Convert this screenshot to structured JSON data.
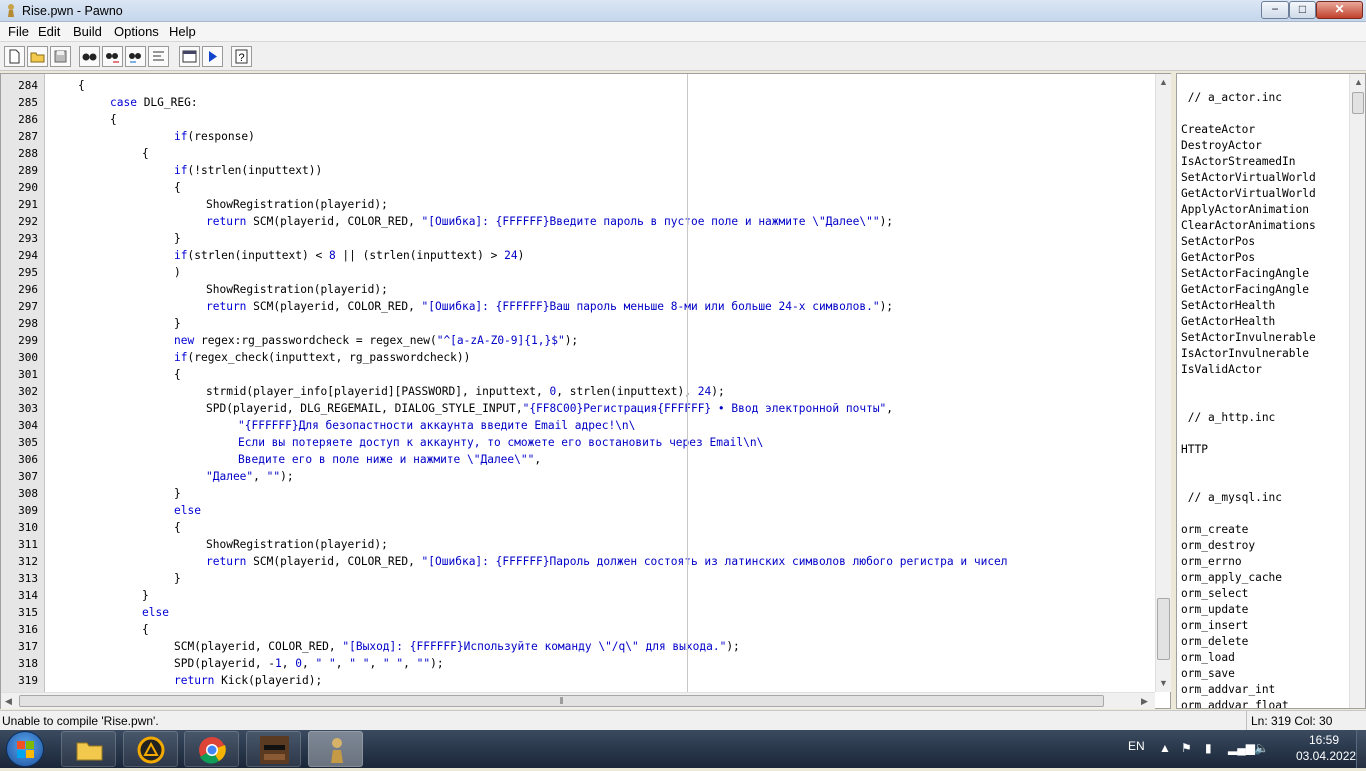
{
  "window": {
    "title": "Rise.pwn - Pawno",
    "minimize_label": "−",
    "maximize_label": "□",
    "close_label": "✕"
  },
  "menu": [
    "File",
    "Edit",
    "Build",
    "Options",
    "Help"
  ],
  "toolbar": [
    "new-icon",
    "open-icon",
    "save-icon",
    "find-icon",
    "find-next-icon",
    "replace-icon",
    "goto-line-icon",
    "function-list-icon",
    "compile-run-icon",
    "help-icon"
  ],
  "editor": {
    "lines": [
      {
        "n": "284",
        "indent": 4,
        "parts": [
          [
            "t",
            "{"
          ]
        ]
      },
      {
        "n": "285",
        "indent": 8,
        "parts": [
          [
            "k",
            "case"
          ],
          [
            "t",
            " DLG_REG:"
          ]
        ]
      },
      {
        "n": "286",
        "indent": 8,
        "parts": [
          [
            "t",
            "{"
          ]
        ]
      },
      {
        "n": "287",
        "indent": 16,
        "parts": [
          [
            "k",
            "if"
          ],
          [
            "t",
            "(response)"
          ]
        ]
      },
      {
        "n": "288",
        "indent": 12,
        "parts": [
          [
            "t",
            "{"
          ]
        ]
      },
      {
        "n": "289",
        "indent": 16,
        "parts": [
          [
            "k",
            "if"
          ],
          [
            "t",
            "(!strlen(inputtext))"
          ]
        ]
      },
      {
        "n": "290",
        "indent": 16,
        "parts": [
          [
            "t",
            "{"
          ]
        ]
      },
      {
        "n": "291",
        "indent": 20,
        "parts": [
          [
            "t",
            "ShowRegistration(playerid);"
          ]
        ]
      },
      {
        "n": "292",
        "indent": 20,
        "parts": [
          [
            "k",
            "return"
          ],
          [
            "t",
            " SCM(playerid, COLOR_RED, "
          ],
          [
            "s",
            "\"[Ошибка]: {FFFFFF}Введите пароль в пустое поле и нажмите \\\"Далее\\\"\""
          ],
          [
            "t",
            ");"
          ]
        ]
      },
      {
        "n": "293",
        "indent": 16,
        "parts": [
          [
            "t",
            "}"
          ]
        ]
      },
      {
        "n": "294",
        "indent": 16,
        "parts": [
          [
            "k",
            "if"
          ],
          [
            "t",
            "(strlen(inputtext) < "
          ],
          [
            "s",
            "8"
          ],
          [
            "t",
            " || (strlen(inputtext) > "
          ],
          [
            "s",
            "24"
          ],
          [
            "t",
            ")"
          ]
        ]
      },
      {
        "n": "295",
        "indent": 16,
        "parts": [
          [
            "t",
            ")"
          ]
        ]
      },
      {
        "n": "296",
        "indent": 20,
        "parts": [
          [
            "t",
            "ShowRegistration(playerid);"
          ]
        ]
      },
      {
        "n": "297",
        "indent": 20,
        "parts": [
          [
            "k",
            "return"
          ],
          [
            "t",
            " SCM(playerid, COLOR_RED, "
          ],
          [
            "s",
            "\"[Ошибка]: {FFFFFF}Ваш пароль меньше 8-ми или больше 24-х символов.\""
          ],
          [
            "t",
            ");"
          ]
        ]
      },
      {
        "n": "298",
        "indent": 16,
        "parts": [
          [
            "t",
            "}"
          ]
        ]
      },
      {
        "n": "299",
        "indent": 16,
        "parts": [
          [
            "k",
            "new"
          ],
          [
            "t",
            " regex:rg_passwordcheck = regex_new("
          ],
          [
            "s",
            "\"^[a-zA-Z0-9]{1,}$\""
          ],
          [
            "t",
            ");"
          ]
        ]
      },
      {
        "n": "300",
        "indent": 16,
        "parts": [
          [
            "k",
            "if"
          ],
          [
            "t",
            "(regex_check(inputtext, rg_passwordcheck))"
          ]
        ]
      },
      {
        "n": "301",
        "indent": 16,
        "parts": [
          [
            "t",
            "{"
          ]
        ]
      },
      {
        "n": "302",
        "indent": 20,
        "parts": [
          [
            "t",
            "strmid(player_info[playerid][PASSWORD], inputtext, "
          ],
          [
            "s",
            "0"
          ],
          [
            "t",
            ", strlen(inputtext), "
          ],
          [
            "s",
            "24"
          ],
          [
            "t",
            ");"
          ]
        ]
      },
      {
        "n": "303",
        "indent": 20,
        "parts": [
          [
            "t",
            "SPD(playerid, DLG_REGEMAIL, DIALOG_STYLE_INPUT,"
          ],
          [
            "s",
            "\"{FF8C00}Регистрация{FFFFFF} • Ввод электронной почты\""
          ],
          [
            "t",
            ","
          ]
        ]
      },
      {
        "n": "304",
        "indent": 24,
        "parts": [
          [
            "s",
            "\"{FFFFFF}Для безопастности аккаунта введите Email адрес!\\n\\"
          ]
        ]
      },
      {
        "n": "305",
        "indent": 24,
        "parts": [
          [
            "s",
            "Если вы потеряете доступ к аккаунту, то сможете его востановить через Email\\n\\"
          ]
        ]
      },
      {
        "n": "306",
        "indent": 24,
        "parts": [
          [
            "s",
            "Введите его в поле ниже и нажмите \\\"Далее\\\"\""
          ],
          [
            "t",
            ","
          ]
        ]
      },
      {
        "n": "307",
        "indent": 20,
        "parts": [
          [
            "s",
            "\"Далее\""
          ],
          [
            "t",
            ", "
          ],
          [
            "s",
            "\"\""
          ],
          [
            "t",
            ");"
          ]
        ]
      },
      {
        "n": "308",
        "indent": 16,
        "parts": [
          [
            "t",
            "}"
          ]
        ]
      },
      {
        "n": "309",
        "indent": 16,
        "parts": [
          [
            "k",
            "else"
          ]
        ]
      },
      {
        "n": "310",
        "indent": 16,
        "parts": [
          [
            "t",
            "{"
          ]
        ]
      },
      {
        "n": "311",
        "indent": 20,
        "parts": [
          [
            "t",
            "ShowRegistration(playerid);"
          ]
        ]
      },
      {
        "n": "312",
        "indent": 20,
        "parts": [
          [
            "k",
            "return"
          ],
          [
            "t",
            " SCM(playerid, COLOR_RED, "
          ],
          [
            "s",
            "\"[Ошибка]: {FFFFFF}Пароль должен состоять из латинских символов любого регистра и чисел"
          ]
        ]
      },
      {
        "n": "313",
        "indent": 16,
        "parts": [
          [
            "t",
            "}"
          ]
        ]
      },
      {
        "n": "314",
        "indent": 12,
        "parts": [
          [
            "t",
            "}"
          ]
        ]
      },
      {
        "n": "315",
        "indent": 12,
        "parts": [
          [
            "k",
            "else"
          ]
        ]
      },
      {
        "n": "316",
        "indent": 12,
        "parts": [
          [
            "t",
            "{"
          ]
        ]
      },
      {
        "n": "317",
        "indent": 16,
        "parts": [
          [
            "t",
            "SCM(playerid, COLOR_RED, "
          ],
          [
            "s",
            "\"[Выход]: {FFFFFF}Используйте команду \\\"/q\\\" для выхода.\""
          ],
          [
            "t",
            ");"
          ]
        ]
      },
      {
        "n": "318",
        "indent": 16,
        "parts": [
          [
            "t",
            "SPD(playerid, -"
          ],
          [
            "s",
            "1"
          ],
          [
            "t",
            ", "
          ],
          [
            "s",
            "0"
          ],
          [
            "t",
            ", "
          ],
          [
            "s",
            "\" \""
          ],
          [
            "t",
            ", "
          ],
          [
            "s",
            "\" \""
          ],
          [
            "t",
            ", "
          ],
          [
            "s",
            "\" \""
          ],
          [
            "t",
            ", "
          ],
          [
            "s",
            "\"\""
          ],
          [
            "t",
            ");"
          ]
        ]
      },
      {
        "n": "319",
        "indent": 16,
        "parts": [
          [
            "k",
            "return"
          ],
          [
            "t",
            " Kick(playerid);"
          ]
        ]
      }
    ]
  },
  "function_list": {
    "lines": [
      " // a_actor.inc",
      "",
      "CreateActor",
      "DestroyActor",
      "IsActorStreamedIn",
      "SetActorVirtualWorld",
      "GetActorVirtualWorld",
      "ApplyActorAnimation",
      "ClearActorAnimations",
      "SetActorPos",
      "GetActorPos",
      "SetActorFacingAngle",
      "GetActorFacingAngle",
      "SetActorHealth",
      "GetActorHealth",
      "SetActorInvulnerable",
      "IsActorInvulnerable",
      "IsValidActor",
      "",
      "",
      " // a_http.inc",
      "",
      "HTTP",
      "",
      "",
      " // a_mysql.inc",
      "",
      "orm_create",
      "orm_destroy",
      "orm_errno",
      "orm_apply_cache",
      "orm_select",
      "orm_update",
      "orm_insert",
      "orm_delete",
      "orm_load",
      "orm_save",
      "orm_addvar_int",
      "orm_addvar_float"
    ]
  },
  "statusbar": {
    "message": "Unable to compile 'Rise.pwn'.",
    "position": "Ln: 319   Col: 30"
  },
  "taskbar": {
    "apps": [
      "explorer-icon",
      "game-launcher-icon",
      "chrome-icon",
      "gta-sa-icon",
      "pawno-icon"
    ],
    "lang": "EN",
    "time": "16:59",
    "date": "03.04.2022"
  },
  "colors": {
    "keyword": "#0000d8",
    "string": "#0000c8",
    "gutter": "#e6e6e6"
  }
}
